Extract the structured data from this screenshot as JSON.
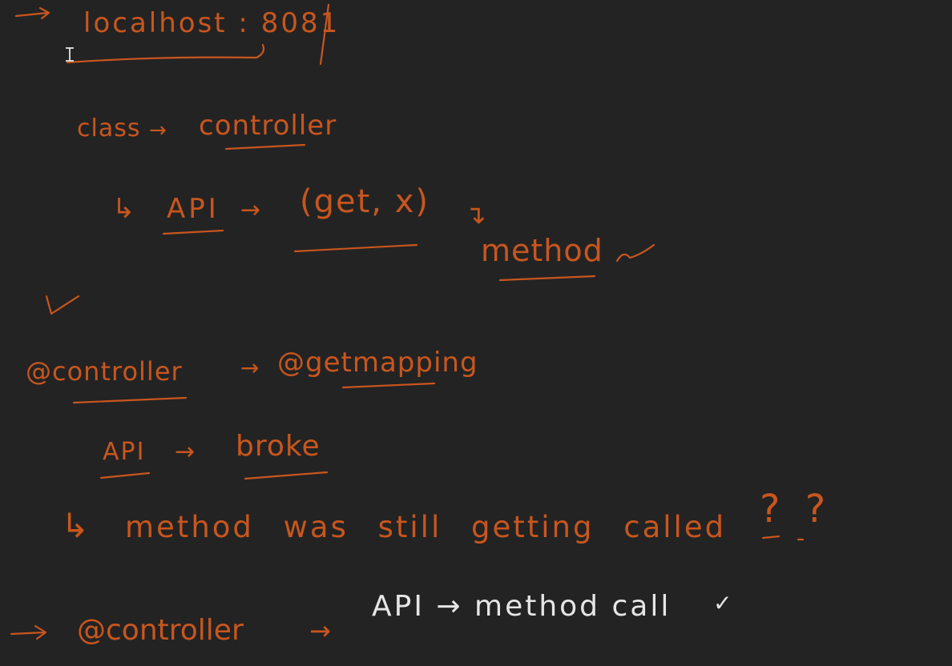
{
  "canvas": {
    "background": "#232323",
    "ink_orange": "#c8561e",
    "ink_white": "#e6e6e6"
  },
  "notes": {
    "line1": {
      "arrow": "→",
      "text": "localhost : 8081",
      "slash": "/"
    },
    "line2": {
      "left": "class",
      "arrow": "→",
      "right": "controller"
    },
    "line3": {
      "hook": "↳",
      "left": "API",
      "arrow": "→",
      "paren": "(get, x)",
      "down_arrow": "↴",
      "result": "method",
      "check": "✓"
    },
    "check_mark": "✓",
    "line4": {
      "left": "@controller",
      "arrow": "→",
      "right": "@getmapping"
    },
    "line5": {
      "left": "API",
      "arrow": "→",
      "right": "broke"
    },
    "line6": {
      "hook": "↳",
      "text": "method was still getting called",
      "marks": "? ?"
    },
    "line7": {
      "arrow": "→",
      "left": "@controller",
      "arrow2": "→",
      "right": "API → method call",
      "check": "✓"
    }
  },
  "cursor_icon": "text-cursor-icon"
}
